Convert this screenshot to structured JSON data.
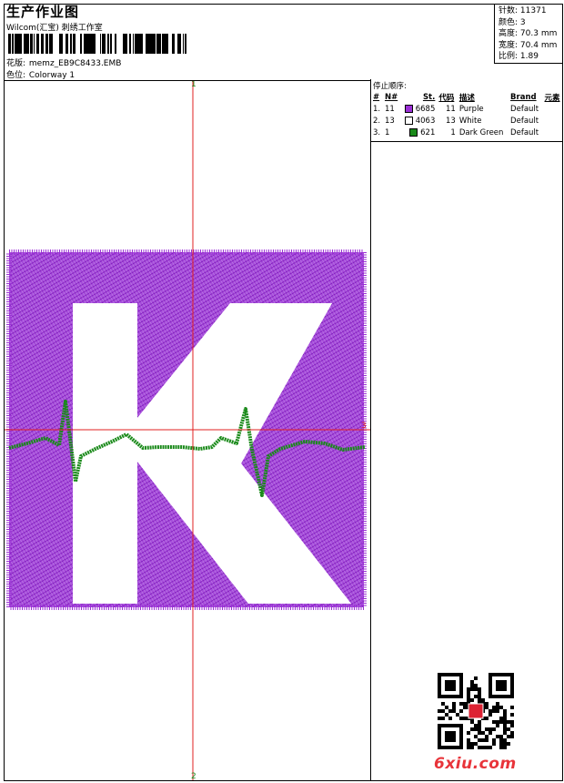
{
  "header": {
    "title": "生产作业图",
    "company": "Wilcom(汇宝) 刺绣工作室",
    "design_label": "花版:",
    "design_value": "memz_EB9C8433.EMB",
    "colorway_label": "色位:",
    "colorway_value": "Colorway 1"
  },
  "stats": [
    {
      "label": "针数:",
      "value": "11371"
    },
    {
      "label": "颜色:",
      "value": "3"
    },
    {
      "label": "高度:",
      "value": "70.3 mm"
    },
    {
      "label": "宽度:",
      "value": "70.4 mm"
    },
    {
      "label": "比例:",
      "value": "1.89"
    }
  ],
  "stop_sequence": {
    "title": "停止顺序:",
    "headers": [
      "#",
      "N#",
      "St.",
      "代码",
      "描述",
      "Brand",
      "元素"
    ],
    "rows": [
      {
        "index": "1.",
        "n": "11",
        "color": "#9b2fd6",
        "stitches": "6685",
        "code": "11",
        "desc": "Purple",
        "brand": "Default"
      },
      {
        "index": "2.",
        "n": "13",
        "color": "#ffffff",
        "stitches": "4063",
        "code": "13",
        "desc": "White",
        "brand": "Default"
      },
      {
        "index": "3.",
        "n": "1",
        "color": "#1a8a1a",
        "stitches": "621",
        "code": "1",
        "desc": "Dark Green",
        "brand": "Default"
      }
    ]
  },
  "crosshair": {
    "top_label": "1",
    "bottom_label": "2",
    "right_label": "3"
  },
  "colors": {
    "purple": "#9b2fd6",
    "green": "#1a8a1a",
    "crosshair": "#e02020"
  },
  "watermark": {
    "text": "6xiu.com"
  }
}
